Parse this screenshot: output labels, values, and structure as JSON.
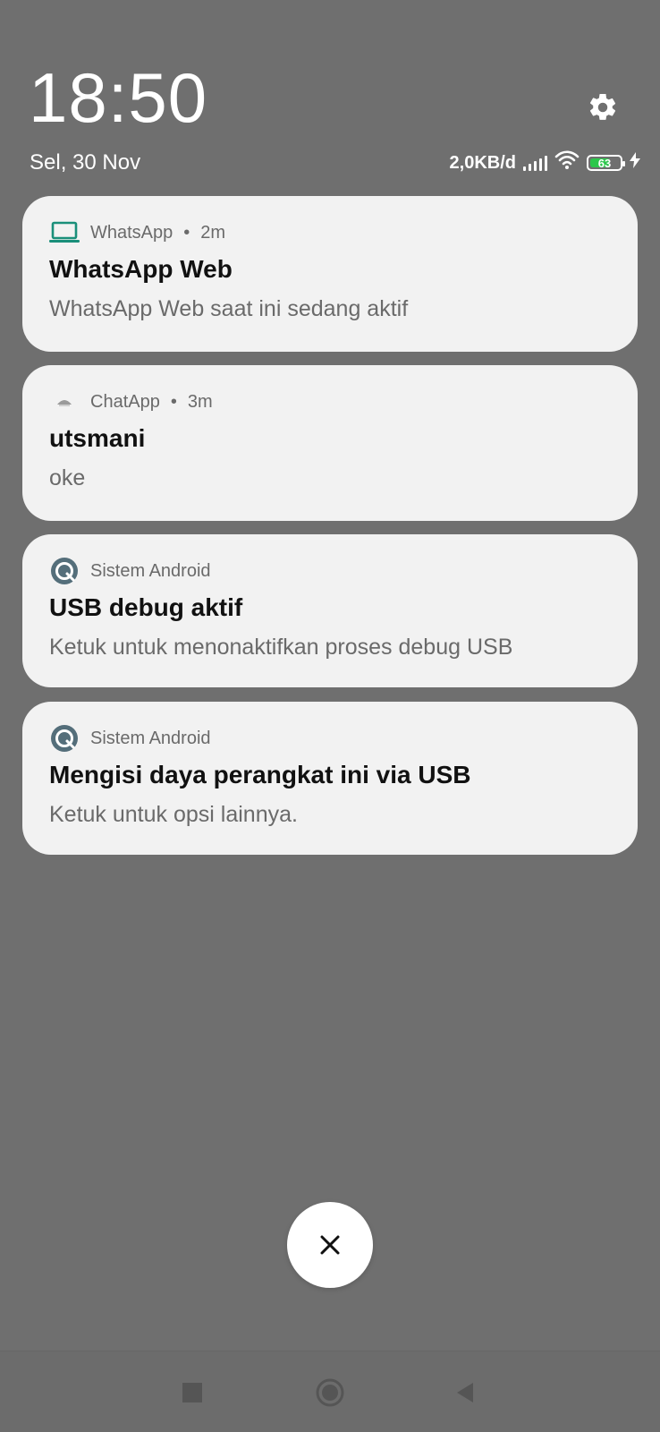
{
  "status_bar": {
    "time": "18:50",
    "date": "Sel, 30 Nov",
    "network_speed": "2,0KB/d",
    "battery_percent": "63"
  },
  "notifications": [
    {
      "app": "WhatsApp",
      "dot": "•",
      "time": "2m",
      "title": "WhatsApp Web",
      "body": "WhatsApp Web saat ini sedang aktif",
      "icon": "laptop-icon",
      "icon_color": "#1a8f7a"
    },
    {
      "app": "ChatApp",
      "dot": "•",
      "time": "3m",
      "title": "utsmani",
      "body": "oke",
      "icon": "chat-app-icon",
      "icon_color": "#999999"
    },
    {
      "app": "Sistem Android",
      "title": "USB debug aktif",
      "body": "Ketuk untuk menonaktifkan proses debug USB",
      "icon": "android-system-icon",
      "icon_color": "#546e7a"
    },
    {
      "app": "Sistem Android",
      "title": "Mengisi daya perangkat ini via USB",
      "body": "Ketuk untuk opsi lainnya.",
      "icon": "android-system-icon",
      "icon_color": "#546e7a"
    }
  ],
  "nav": {
    "recents_icon": "square-icon",
    "home_icon": "circle-icon",
    "back_icon": "triangle-back-icon"
  },
  "colors": {
    "background": "#6f6f6f",
    "card": "#f2f2f2",
    "battery_fill": "#2bc74a"
  }
}
